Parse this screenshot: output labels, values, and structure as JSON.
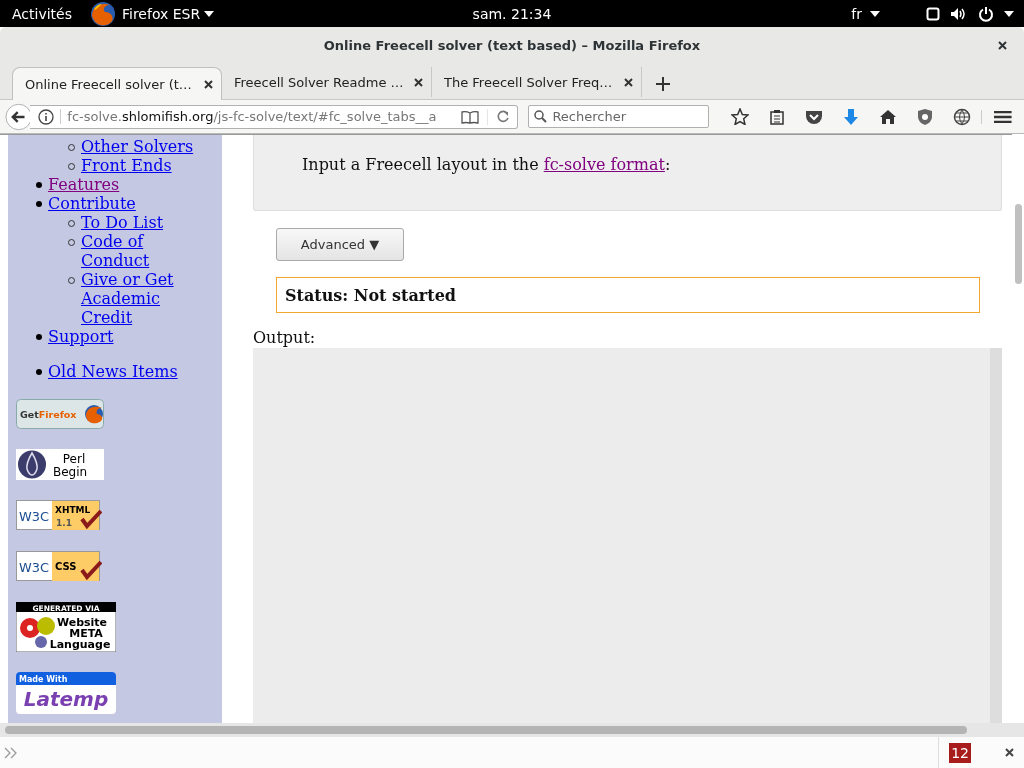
{
  "top_bar": {
    "activities": "Activités",
    "app_menu": "Firefox ESR",
    "clock": "sam. 21:34",
    "language": "fr"
  },
  "window": {
    "title": "Online Freecell solver (text based) – Mozilla Firefox"
  },
  "tabs": [
    {
      "label": "Online Freecell solver (t…",
      "selected": true
    },
    {
      "label": "Freecell Solver Readme …",
      "selected": false
    },
    {
      "label": "The Freecell Solver Freq…",
      "selected": false
    }
  ],
  "nav_bar": {
    "url": {
      "prefix": "fc-solve.",
      "domain": "shlomifish.org",
      "path": "/js-fc-solve/text/#fc_solve_tabs__a"
    },
    "search": {
      "placeholder": "Rechercher"
    }
  },
  "sidebar": {
    "menu": [
      {
        "children": [
          {
            "label": "Other Solvers",
            "visited": false
          },
          {
            "label": "Front Ends",
            "visited": false
          }
        ]
      },
      {
        "label": "Features",
        "visited": true
      },
      {
        "label": "Contribute",
        "visited": false,
        "children": [
          {
            "label": "To Do List",
            "visited": false
          },
          {
            "label": "Code of Conduct",
            "visited": false
          },
          {
            "label": "Give or Get Academic Credit",
            "visited": false
          }
        ]
      },
      {
        "label": "Support",
        "visited": false
      }
    ],
    "news": [
      {
        "label": "Old News Items",
        "visited": false
      }
    ],
    "badges": [
      {
        "kind": "get-firefox",
        "texts": [
          "Get",
          "Firefox"
        ]
      },
      {
        "kind": "perl-begin",
        "texts": [
          "Perl",
          "Begin"
        ]
      },
      {
        "kind": "w3c",
        "texts": [
          "W3C",
          "XHTML",
          "1.1"
        ]
      },
      {
        "kind": "w3c",
        "texts": [
          "W3C",
          "CSS"
        ]
      },
      {
        "kind": "wml",
        "texts": [
          "GENERATED VIA",
          "Website",
          "META",
          "Language"
        ]
      },
      {
        "kind": "latemp",
        "texts": [
          "Made With",
          "Latemp"
        ]
      }
    ]
  },
  "main": {
    "intro": {
      "before": "Input a Freecell layout in the ",
      "link": "fc-solve format",
      "link_visited": true,
      "after": ":"
    },
    "advanced_button": "Advanced ▼",
    "status": "Status: Not started",
    "output_label": "Output:"
  },
  "addon_bar": {
    "badge": "12"
  }
}
